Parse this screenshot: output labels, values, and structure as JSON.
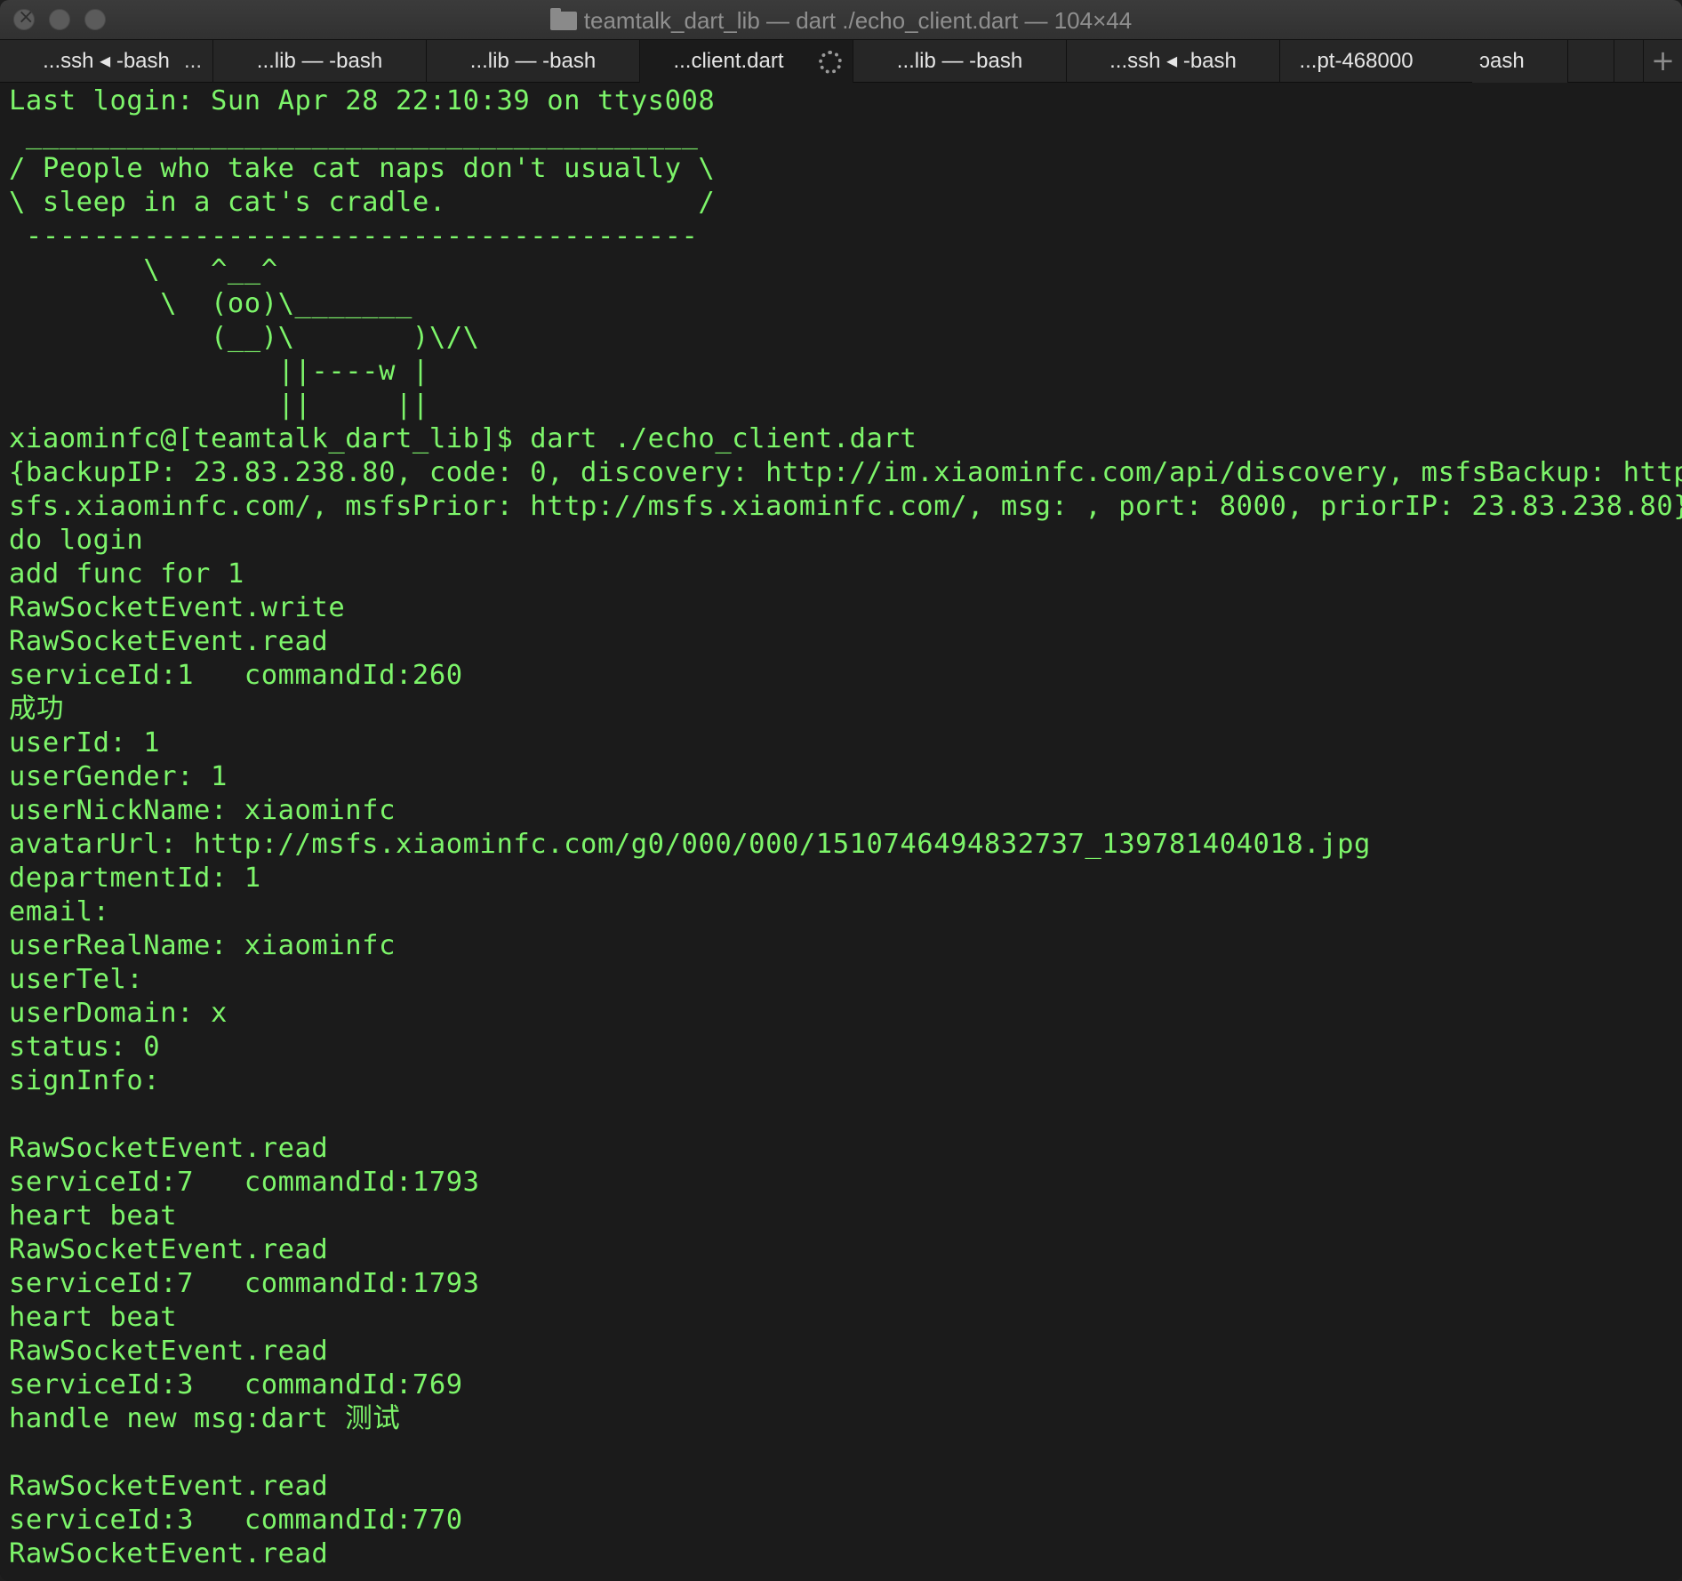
{
  "window": {
    "title": "teamtalk_dart_lib — dart ./echo_client.dart — 104×44"
  },
  "tabs": [
    {
      "label": "...ssh ◂ -bash",
      "extra": "..."
    },
    {
      "label": "...lib — -bash"
    },
    {
      "label": "...lib — -bash"
    },
    {
      "label": "...client.dart",
      "active": true
    },
    {
      "label": "...lib — -bash"
    },
    {
      "label": "...ssh ◂ -bash"
    },
    {
      "label": "...pt-468000"
    },
    {
      "label": "ɔash"
    }
  ],
  "new_tab_icon": "+",
  "terminal": {
    "lines": [
      "Last login: Sun Apr 28 22:10:39 on ttys008",
      " ________________________________________",
      "/ People who take cat naps don't usually \\",
      "\\ sleep in a cat's cradle.               /",
      " ----------------------------------------",
      "        \\   ^__^",
      "         \\  (oo)\\_______",
      "            (__)\\       )\\/\\",
      "                ||----w |",
      "                ||     ||",
      "xiaominfc@[teamtalk_dart_lib]$ dart ./echo_client.dart",
      "{backupIP: 23.83.238.80, code: 0, discovery: http://im.xiaominfc.com/api/discovery, msfsBackup: http://m",
      "sfs.xiaominfc.com/, msfsPrior: http://msfs.xiaominfc.com/, msg: , port: 8000, priorIP: 23.83.238.80}",
      "do login",
      "add func for 1",
      "RawSocketEvent.write",
      "RawSocketEvent.read",
      "serviceId:1   commandId:260",
      "成功",
      "userId: 1",
      "userGender: 1",
      "userNickName: xiaominfc",
      "avatarUrl: http://msfs.xiaominfc.com/g0/000/000/1510746494832737_139781404018.jpg",
      "departmentId: 1",
      "email:",
      "userRealName: xiaominfc",
      "userTel:",
      "userDomain: x",
      "status: 0",
      "signInfo:",
      "",
      "RawSocketEvent.read",
      "serviceId:7   commandId:1793",
      "heart beat",
      "RawSocketEvent.read",
      "serviceId:7   commandId:1793",
      "heart beat",
      "RawSocketEvent.read",
      "serviceId:3   commandId:769",
      "handle new msg:dart 测试",
      "",
      "RawSocketEvent.read",
      "serviceId:3   commandId:770",
      "RawSocketEvent.read"
    ]
  },
  "colors": {
    "terminal_text": "#7df56a",
    "terminal_background": "#1b1b1b"
  }
}
